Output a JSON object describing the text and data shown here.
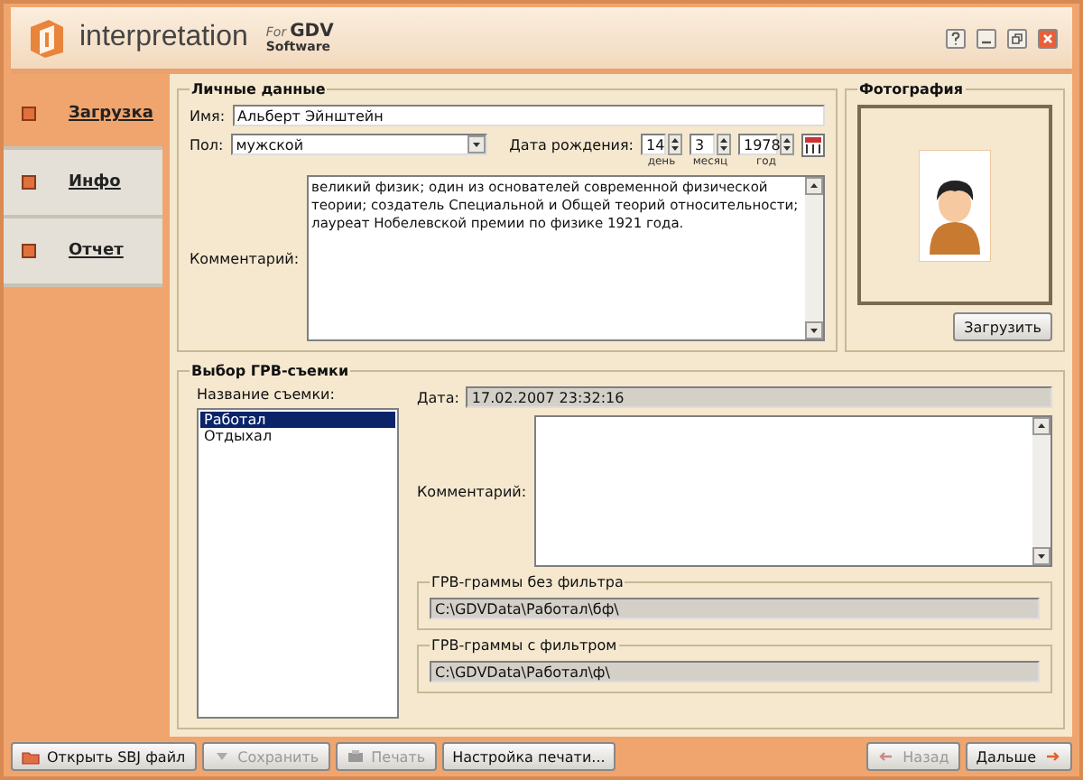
{
  "window": {
    "logo": "interpretation",
    "brand_for": "For",
    "brand_name": "GDV",
    "brand_sub": "Software"
  },
  "sidebar": {
    "items": [
      {
        "label": "Загрузка",
        "selected": true
      },
      {
        "label": "Инфо",
        "selected": false
      },
      {
        "label": "Отчет",
        "selected": false
      }
    ]
  },
  "personal": {
    "legend": "Личные данные",
    "name_label": "Имя:",
    "name_value": "Альберт Эйнштейн",
    "gender_label": "Пол:",
    "gender_value": "мужской",
    "birth_label": "Дата рождения:",
    "date_parts": [
      {
        "value": "14",
        "caption": "день"
      },
      {
        "value": "3",
        "caption": "месяц"
      },
      {
        "value": "1978",
        "caption": "год"
      }
    ],
    "comment_label": "Комментарий:",
    "comment_value": "великий физик; один из основателей современной физической теории; создатель Специальной и Общей теорий относительности; лауреат Нобелевской премии по физике 1921 года."
  },
  "photo": {
    "legend": "Фотография",
    "button": "Загрузить"
  },
  "session": {
    "legend": "Выбор ГРВ-съемки",
    "list_label": "Название съемки:",
    "items": [
      {
        "label": "Работал",
        "selected": true
      },
      {
        "label": "Отдыхал",
        "selected": false
      }
    ],
    "date_label": "Дата:",
    "date_value": "17.02.2007 23:32:16",
    "comment_label": "Комментарий:",
    "paths": [
      {
        "legend": "ГРВ-граммы без фильтра",
        "value": "C:\\GDVData\\Работал\\бф\\"
      },
      {
        "legend": "ГРВ-граммы с фильтром",
        "value": "C:\\GDVData\\Работал\\ф\\"
      }
    ]
  },
  "footer": {
    "left": [
      {
        "label": "Открыть SBJ файл",
        "kind": "open",
        "disabled": false
      },
      {
        "label": "Сохранить",
        "kind": "save",
        "disabled": true
      },
      {
        "label": "Печать",
        "kind": "print",
        "disabled": true
      },
      {
        "label": "Настройка печати...",
        "kind": "plain",
        "disabled": false
      }
    ],
    "right": [
      {
        "label": "Назад",
        "kind": "back",
        "disabled": true
      },
      {
        "label": "Дальше",
        "kind": "next",
        "disabled": false
      }
    ]
  }
}
